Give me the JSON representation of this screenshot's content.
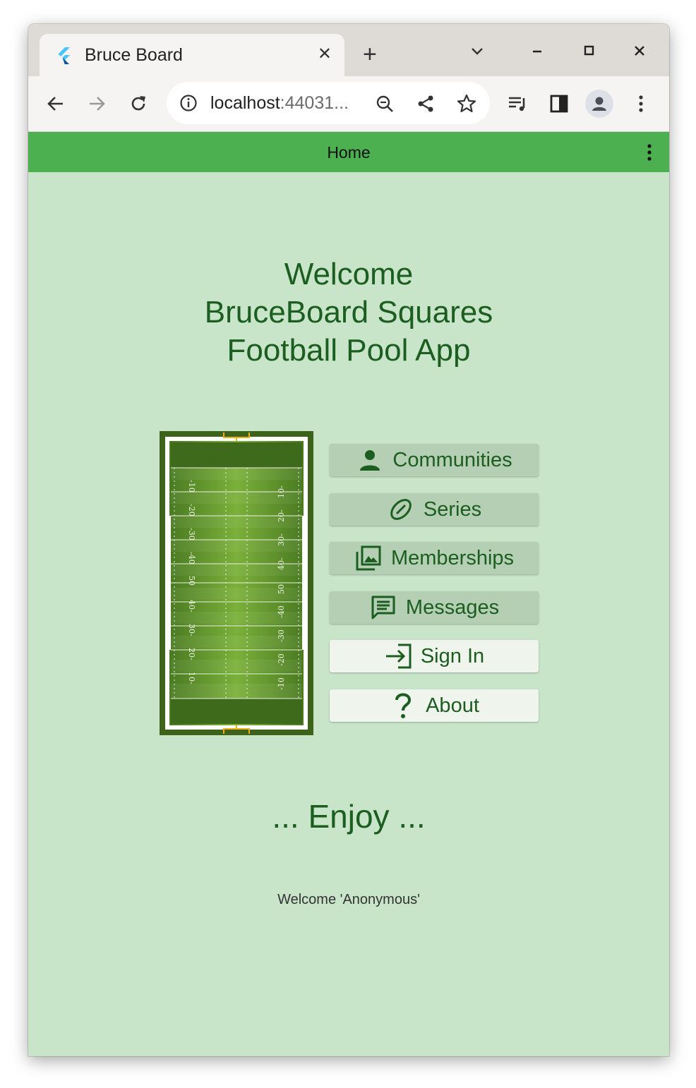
{
  "browser": {
    "tab_title": "Bruce Board",
    "tab_favicon": "flutter-icon",
    "url_host": "localhost",
    "url_rest": ":44031...",
    "tabstrip_icons": [
      "close-icon",
      "new-tab-icon",
      "chevron-down-icon",
      "minimize-icon",
      "maximize-icon",
      "window-close-icon"
    ],
    "toolbar_icons": [
      "back-arrow-icon",
      "forward-arrow-icon",
      "reload-icon",
      "info-icon",
      "zoom-icon",
      "share-icon",
      "star-icon",
      "media-icon",
      "side-panel-icon",
      "profile-icon",
      "more-vert-icon"
    ]
  },
  "appbar": {
    "title": "Home",
    "color": "#4caf50",
    "menu_icon": "more-vert-icon"
  },
  "main": {
    "welcome_lines": [
      "Welcome",
      "BruceBoard Squares",
      "Football Pool App"
    ],
    "field_image": "football-field-image",
    "field_numbers_left": [
      "-10",
      "-20",
      "-30",
      "-40",
      "50",
      "40-",
      "30-",
      "20-",
      "10-"
    ],
    "field_numbers_right": [
      "10-",
      "20-",
      "30-",
      "40-",
      "50",
      "-40",
      "-30",
      "-20",
      "-10"
    ],
    "menu": [
      {
        "label": "Communities",
        "icon": "person-icon",
        "style": "dark"
      },
      {
        "label": "Series",
        "icon": "football-icon",
        "style": "dark"
      },
      {
        "label": "Memberships",
        "icon": "photo-library-icon",
        "style": "dark"
      },
      {
        "label": "Messages",
        "icon": "message-icon",
        "style": "dark"
      },
      {
        "label": "Sign In",
        "icon": "login-icon",
        "style": "light"
      },
      {
        "label": "About",
        "icon": "question-mark-icon",
        "style": "light"
      }
    ],
    "enjoy": "... Enjoy ...",
    "user_greeting": "Welcome 'Anonymous'",
    "background_color": "#c8e4c9",
    "text_color": "#1b5e20"
  }
}
